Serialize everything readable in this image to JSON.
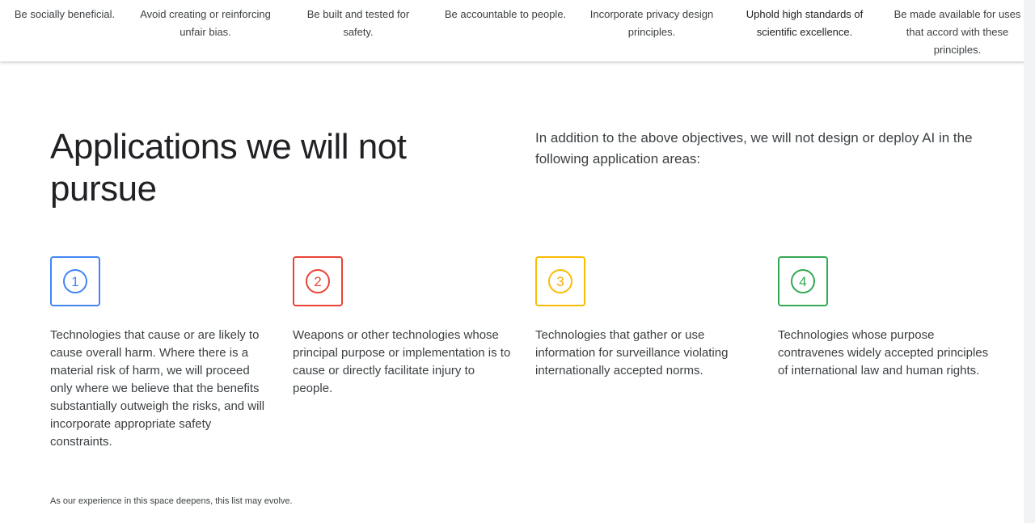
{
  "principles_nav": {
    "items": [
      {
        "label": "Be socially beneficial."
      },
      {
        "label": "Avoid creating or reinforcing unfair bias."
      },
      {
        "label": "Be built and tested for safety."
      },
      {
        "label": "Be accountable to people."
      },
      {
        "label": "Incorporate privacy design principles."
      },
      {
        "label": "Uphold high standards of scientific excellence.",
        "active": true
      },
      {
        "label": "Be made available for uses that accord with these principles."
      }
    ]
  },
  "section": {
    "title": "Applications we will not pursue",
    "intro": "In addition to the above objectives, we will not design or deploy AI in the following application areas:",
    "items": [
      {
        "number": "1",
        "color": "#4285F4",
        "text": "Technologies that cause or are likely to cause overall harm. Where there is a material risk of harm, we will proceed only where we believe that the benefits substantially outweigh the risks, and will incorporate appropriate safety constraints."
      },
      {
        "number": "2",
        "color": "#EA4335",
        "text": "Weapons or other technologies whose principal purpose or implementation is to cause or directly facilitate injury to people."
      },
      {
        "number": "3",
        "color": "#FBBC04",
        "text": "Technologies that gather or use information for surveillance violating internationally accepted norms."
      },
      {
        "number": "4",
        "color": "#34A853",
        "text": "Technologies whose purpose contravenes widely accepted principles of international law and human rights."
      }
    ],
    "footnote": "As our experience in this space deepens, this list may evolve."
  }
}
